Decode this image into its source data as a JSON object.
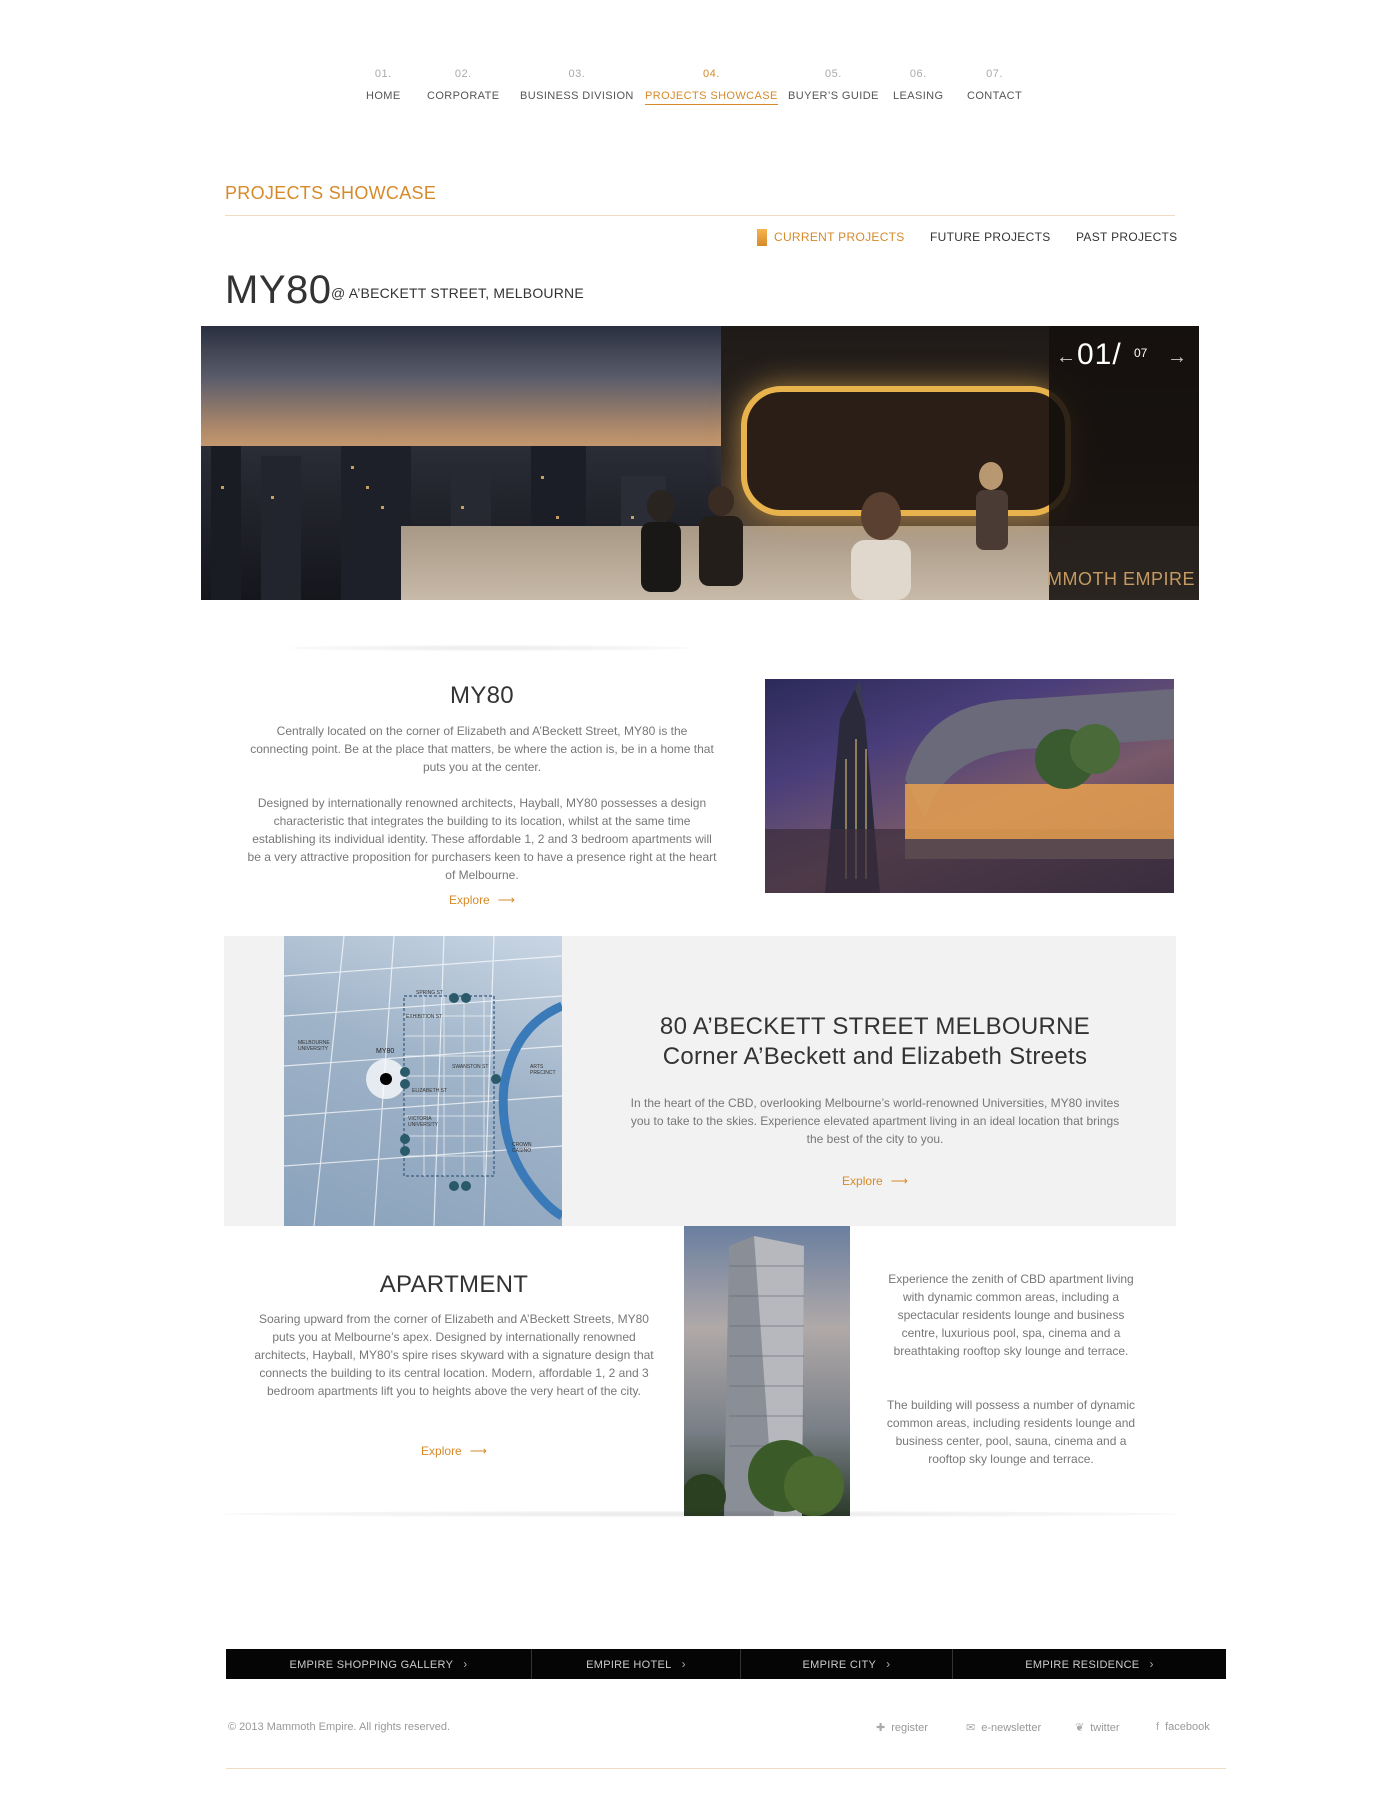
{
  "nav": [
    {
      "num": "01.",
      "label": "HOME"
    },
    {
      "num": "02.",
      "label": "CORPORATE"
    },
    {
      "num": "03.",
      "label": "BUSINESS DIVISION"
    },
    {
      "num": "04.",
      "label": "PROJECTS SHOWCASE",
      "active": true
    },
    {
      "num": "05.",
      "label": "BUYER’S GUIDE"
    },
    {
      "num": "06.",
      "label": "LEASING"
    },
    {
      "num": "07.",
      "label": "CONTACT"
    }
  ],
  "section": {
    "title": "PROJECTS SHOWCASE"
  },
  "tabs": [
    {
      "label": "CURRENT PROJECTS",
      "active": true
    },
    {
      "label": "FUTURE PROJECTS"
    },
    {
      "label": "PAST PROJECTS"
    }
  ],
  "project": {
    "name": "MY80",
    "location": "@ A’BECKETT STREET, MELBOURNE"
  },
  "hero": {
    "current": "01/",
    "total": "07",
    "brand": "MMOTH EMPIRE",
    "prev_arrow": "←",
    "next_arrow": "→"
  },
  "block1": {
    "title": "MY80",
    "p1": "Centrally located on the corner of Elizabeth and A’Beckett Street, MY80 is the connecting point. Be at the place that matters, be where the action is, be in a home that puts you at the center.",
    "p2": "Designed by internationally renowned architects, Hayball, MY80 possesses a design characteristic that integrates the building to its location, whilst at the same time establishing its individual identity. These affordable 1, 2 and 3 bedroom apartments will be a very attractive proposition for purchasers keen to have a presence right at the heart of Melbourne.",
    "explore": "Explore"
  },
  "block2": {
    "title_line1": "80 A’BECKETT STREET MELBOURNE",
    "title_line2": "Corner A’Beckett and Elizabeth Streets",
    "text": "In the heart of the CBD, overlooking Melbourne’s world-renowned Universities, MY80 invites you to take to the skies. Experience elevated apartment living in an ideal location that brings the best of the city to you.",
    "explore": "Explore"
  },
  "map": {
    "marker": "MY80",
    "labels": [
      "ELIZABETH ST",
      "SWANSTON ST",
      "EXHIBITION ST",
      "SPRING ST",
      "VICTORIA UNIVERSITY",
      "CROWN CASINO",
      "ARTS PRECINCT",
      "MELBOURNE UNIVERSITY"
    ]
  },
  "block3": {
    "title": "APARTMENT",
    "text": "Soaring upward from the corner of Elizabeth and A’Beckett Streets, MY80 puts you at Melbourne’s apex. Designed by internationally renowned architects, Hayball, MY80’s spire rises skyward with a signature design that connects the building to its central location. Modern, affordable 1, 2 and 3 bedroom apartments lift you to heights above the very heart of the city.",
    "explore": "Explore",
    "side_p1": "Experience the zenith of CBD apartment living with dynamic common areas, including a spectacular residents lounge and business centre, luxurious pool, spa, cinema and a breathtaking rooftop sky lounge and terrace.",
    "side_p2": "The building will possess a number of dynamic common areas, including residents lounge and business center, pool, sauna, cinema and a rooftop sky lounge and terrace."
  },
  "footer_links": [
    "EMPIRE SHOPPING GALLERY",
    "EMPIRE HOTEL",
    "EMPIRE CITY",
    "EMPIRE RESIDENCE"
  ],
  "footer": {
    "copyright": "© 2013 Mammoth Empire. All rights reserved.",
    "social": [
      {
        "icon": "plus-icon",
        "label": "register"
      },
      {
        "icon": "envelope-icon",
        "label": "e-newsletter"
      },
      {
        "icon": "twitter-icon",
        "label": "twitter"
      },
      {
        "icon": "facebook-icon",
        "label": "facebook"
      }
    ]
  },
  "colors": {
    "accent": "#d68a2a",
    "footer_bar": "#050505",
    "map_bg": "#f2f2f2"
  }
}
